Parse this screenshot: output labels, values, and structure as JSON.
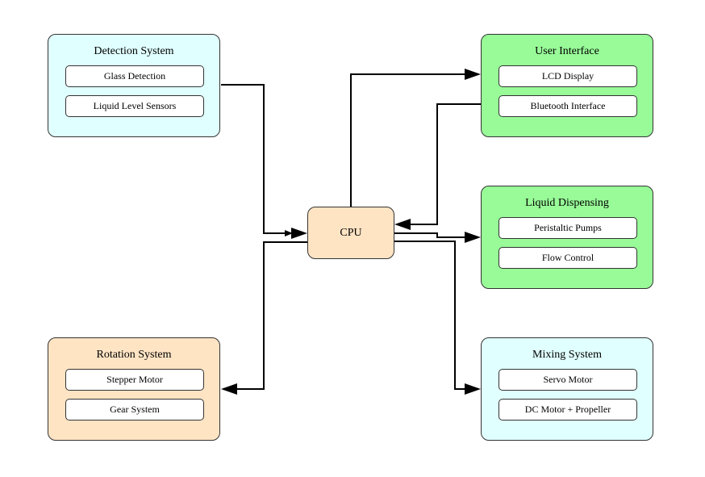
{
  "diagram": {
    "cpu": {
      "label": "CPU",
      "color": "#ffe4c4"
    },
    "groups": [
      {
        "id": "detection",
        "title": "Detection System",
        "color": "#e0ffff",
        "items": [
          "Glass Detection",
          "Liquid Level Sensors"
        ]
      },
      {
        "id": "user-interface",
        "title": "User Interface",
        "color": "#98fb98",
        "items": [
          "LCD Display",
          "Bluetooth Interface"
        ]
      },
      {
        "id": "liquid-dispensing",
        "title": "Liquid Dispensing",
        "color": "#98fb98",
        "items": [
          "Peristaltic Pumps",
          "Flow Control"
        ]
      },
      {
        "id": "rotation",
        "title": "Rotation System",
        "color": "#ffe4c4",
        "items": [
          "Stepper Motor",
          "Gear System"
        ]
      },
      {
        "id": "mixing",
        "title": "Mixing System",
        "color": "#e0ffff",
        "items": [
          "Servo Motor",
          "DC Motor + Propeller"
        ]
      }
    ],
    "edges": [
      {
        "from": "Detection System",
        "to": "CPU"
      },
      {
        "from": "CPU",
        "to": "User Interface"
      },
      {
        "from": "User Interface",
        "to": "CPU"
      },
      {
        "from": "CPU",
        "to": "Liquid Dispensing"
      },
      {
        "from": "CPU",
        "to": "Rotation System"
      },
      {
        "from": "CPU",
        "to": "Mixing System"
      }
    ]
  }
}
